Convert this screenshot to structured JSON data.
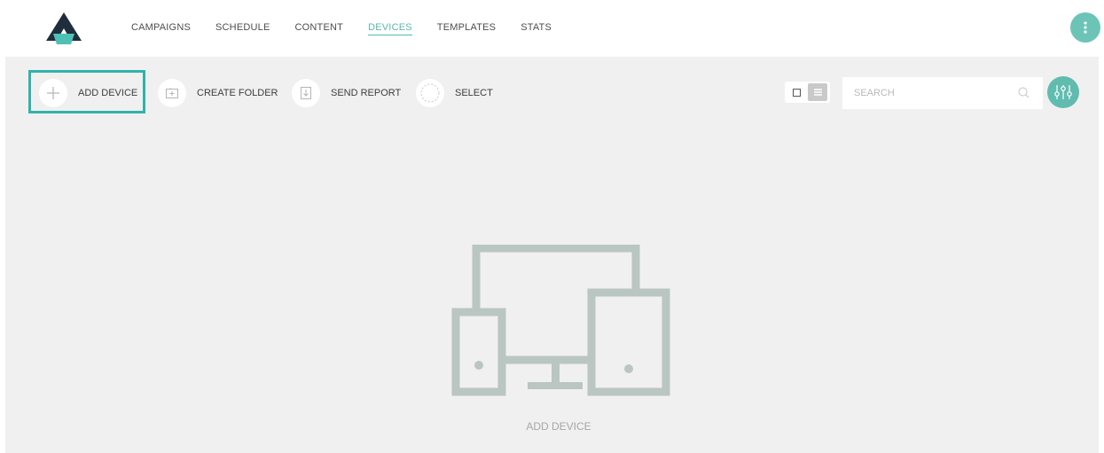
{
  "nav": {
    "items": [
      {
        "label": "CAMPAIGNS"
      },
      {
        "label": "SCHEDULE"
      },
      {
        "label": "CONTENT"
      },
      {
        "label": "DEVICES",
        "active": true
      },
      {
        "label": "TEMPLATES"
      },
      {
        "label": "STATS"
      }
    ],
    "menu_icon": "kebab-menu-icon"
  },
  "toolbar": {
    "add_device": "ADD DEVICE",
    "create_folder": "CREATE FOLDER",
    "send_report": "SEND REPORT",
    "select": "SELECT"
  },
  "search": {
    "placeholder": "SEARCH"
  },
  "empty_state": {
    "label": "ADD DEVICE",
    "icon": "devices-icon"
  },
  "colors": {
    "accent": "#5fbcaf",
    "highlight": "#2fb3aa",
    "background": "#f0f0f0"
  }
}
